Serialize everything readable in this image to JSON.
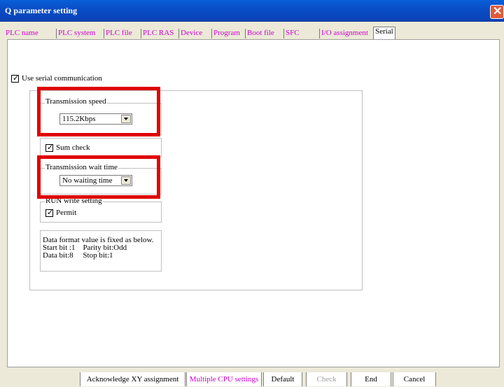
{
  "window": {
    "title": "Q parameter setting",
    "close_glyph": "✕"
  },
  "tabs": [
    {
      "label": "PLC name"
    },
    {
      "label": "PLC system"
    },
    {
      "label": "PLC file"
    },
    {
      "label": "PLC RAS"
    },
    {
      "label": "Device"
    },
    {
      "label": "Program"
    },
    {
      "label": "Boot file"
    },
    {
      "label": "SFC"
    },
    {
      "label": "I/O assignment"
    },
    {
      "label": "Serial",
      "active": true
    }
  ],
  "serial": {
    "use_serial": {
      "label": "Use serial communication",
      "checked": true
    },
    "transmission_speed": {
      "group_label": "Transmission speed",
      "value": "115.2Kbps"
    },
    "sum_check": {
      "label": "Sum check",
      "checked": true
    },
    "wait_time": {
      "group_label": "Transmission wait time",
      "value": "No waiting time"
    },
    "run_write": {
      "group_label": "RUN write setting",
      "permit_label": "Permit",
      "checked": true
    },
    "data_format": {
      "line1": "Data format value is fixed as below.",
      "line2": "Start bit :1    Parity bit:Odd",
      "line3": "Data bit:8     Stop bit:1"
    }
  },
  "buttons": {
    "acknowledge": "Acknowledge XY assignment",
    "multiple_cpu": "Multiple CPU settings",
    "default": "Default",
    "check": "Check",
    "end": "End",
    "cancel": "Cancel"
  },
  "colors": {
    "title_bar": "#0a4cc4",
    "tab_link": "#d000d0",
    "highlight": "#e00000",
    "dialog_bg": "#ece9d8"
  },
  "icons": {
    "close": "close-icon",
    "dropdown": "chevron-down-icon",
    "checkbox": "check-icon"
  }
}
